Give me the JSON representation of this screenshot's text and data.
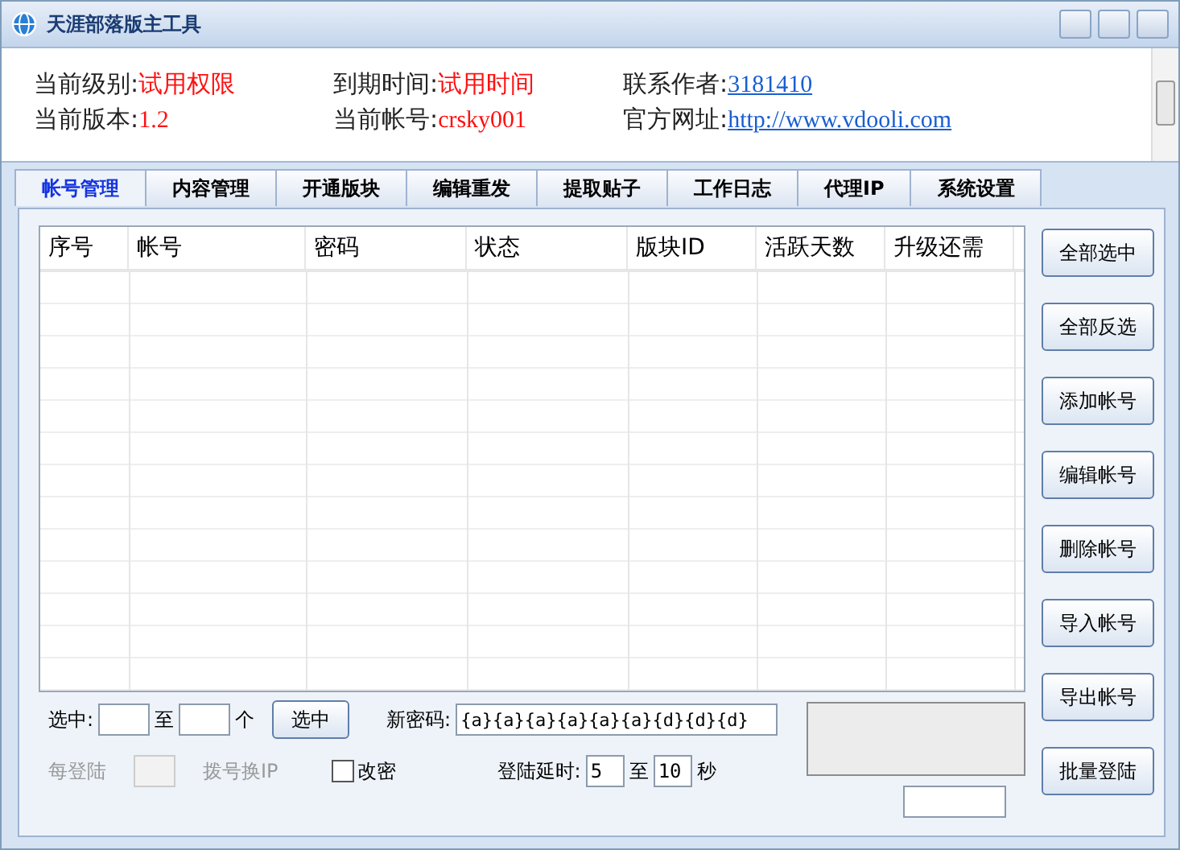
{
  "window": {
    "title": "天涯部落版主工具"
  },
  "info": [
    {
      "label": "当前级别:",
      "value": "试用权限",
      "kind": "red"
    },
    {
      "label": "到期时间:",
      "value": "试用时间",
      "kind": "red"
    },
    {
      "label": "联系作者:",
      "value": "3181410",
      "kind": "link"
    },
    {
      "label": "当前版本:",
      "value": "1.2",
      "kind": "red"
    },
    {
      "label": "当前帐号:",
      "value": "crsky001",
      "kind": "red"
    },
    {
      "label": "官方网址:",
      "value": "http://www.vdooli.com",
      "kind": "link"
    }
  ],
  "tabs": [
    {
      "label": "帐号管理",
      "selected": true
    },
    {
      "label": "内容管理",
      "selected": false
    },
    {
      "label": "开通版块",
      "selected": false
    },
    {
      "label": "编辑重发",
      "selected": false
    },
    {
      "label": "提取贴子",
      "selected": false
    },
    {
      "label": "工作日志",
      "selected": false
    },
    {
      "label": "代理IP",
      "selected": false
    },
    {
      "label": "系统设置",
      "selected": false
    }
  ],
  "table": {
    "columns": [
      "序号",
      "帐号",
      "密码",
      "状态",
      "版块ID",
      "活跃天数",
      "升级还需"
    ]
  },
  "side_buttons": [
    "全部选中",
    "全部反选",
    "添加帐号",
    "编辑帐号",
    "删除帐号",
    "导入帐号",
    "导出帐号",
    "批量登陆"
  ],
  "select_row": {
    "label": "选中:",
    "to": "至",
    "unit": "个",
    "button": "选中"
  },
  "new_password": {
    "label": "新密码:",
    "value": "{a}{a}{a}{a}{a}{a}{d}{d}{d}"
  },
  "dial_row": {
    "label": "每登陆",
    "suffix": "拨号换IP",
    "disabled": true
  },
  "change_password": {
    "label": "改密",
    "checked": false
  },
  "login_delay": {
    "label": "登陆延时:",
    "from": "5",
    "to_label": "至",
    "to": "10",
    "unit": "秒"
  }
}
